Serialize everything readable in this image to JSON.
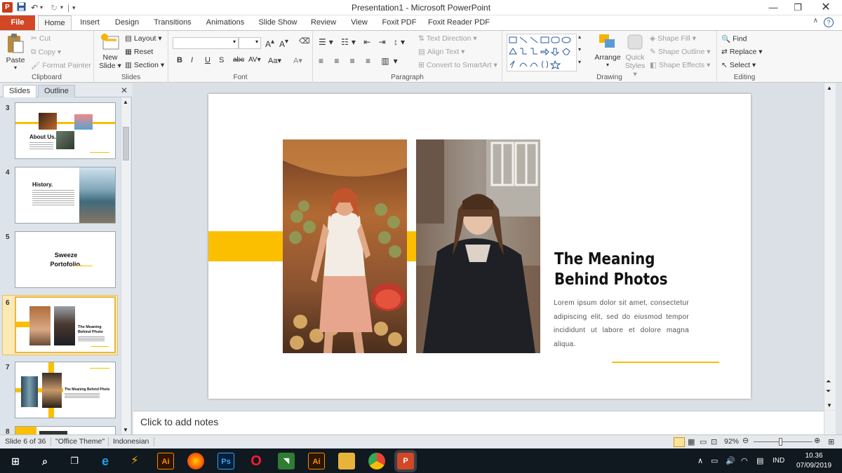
{
  "window": {
    "title": "Presentation1 - Microsoft PowerPoint",
    "app_icon_letter": "P"
  },
  "tabs": [
    "File",
    "Home",
    "Insert",
    "Design",
    "Transitions",
    "Animations",
    "Slide Show",
    "Review",
    "View",
    "Foxit PDF",
    "Foxit Reader PDF"
  ],
  "ribbon": {
    "clipboard": {
      "label": "Clipboard",
      "paste": "Paste",
      "cut": "Cut",
      "copy": "Copy",
      "format_painter": "Format Painter"
    },
    "slides": {
      "label": "Slides",
      "new_slide_1": "New",
      "new_slide_2": "Slide",
      "layout": "Layout",
      "reset": "Reset",
      "section": "Section"
    },
    "font": {
      "label": "Font",
      "b": "B",
      "i": "I",
      "u": "U",
      "s": "S",
      "abc": "abc",
      "av": "AV",
      "aa": "Aa",
      "a": "A"
    },
    "paragraph": {
      "label": "Paragraph",
      "text_direction": "Text Direction",
      "align_text": "Align Text",
      "convert_smartart": "Convert to SmartArt"
    },
    "drawing": {
      "label": "Drawing",
      "arrange": "Arrange",
      "quick_styles_1": "Quick",
      "quick_styles_2": "Styles",
      "shape_fill": "Shape Fill",
      "shape_outline": "Shape Outline",
      "shape_effects": "Shape Effects"
    },
    "editing": {
      "label": "Editing",
      "find": "Find",
      "replace": "Replace",
      "select": "Select"
    }
  },
  "left_pane": {
    "tab_slides": "Slides",
    "tab_outline": "Outline",
    "slides": [
      {
        "num": "3",
        "title": "About Us."
      },
      {
        "num": "4",
        "title": "History."
      },
      {
        "num": "5",
        "title_1": "Sweeze",
        "title_2": "Portofolio."
      },
      {
        "num": "6",
        "title_1": "The Meaning",
        "title_2": "Behind Photo"
      },
      {
        "num": "7",
        "title": "The Meaning Behind Photo"
      },
      {
        "num": "8"
      }
    ]
  },
  "slide": {
    "heading_1": "The Meaning",
    "heading_2": "Behind Photos",
    "body": "Lorem ipsum dolor sit amet, consectetur adipiscing elit, sed do eiusmod tempor incididunt ut labore et dolore magna aliqua.",
    "accent_color": "#fbbf00"
  },
  "notes": {
    "placeholder": "Click to add notes"
  },
  "status": {
    "slide_of": "Slide 6 of 36",
    "theme": "\"Office Theme\"",
    "language": "Indonesian",
    "zoom": "92%"
  },
  "taskbar": {
    "time": "10.36",
    "date": "07/09/2019",
    "lang": "IND",
    "icons": [
      "windows-start",
      "search",
      "task-view",
      "internet-explorer",
      "app",
      "illustrator",
      "firefox",
      "photoshop",
      "opera",
      "app",
      "illustrator",
      "file-explorer",
      "chrome",
      "powerpoint"
    ]
  }
}
